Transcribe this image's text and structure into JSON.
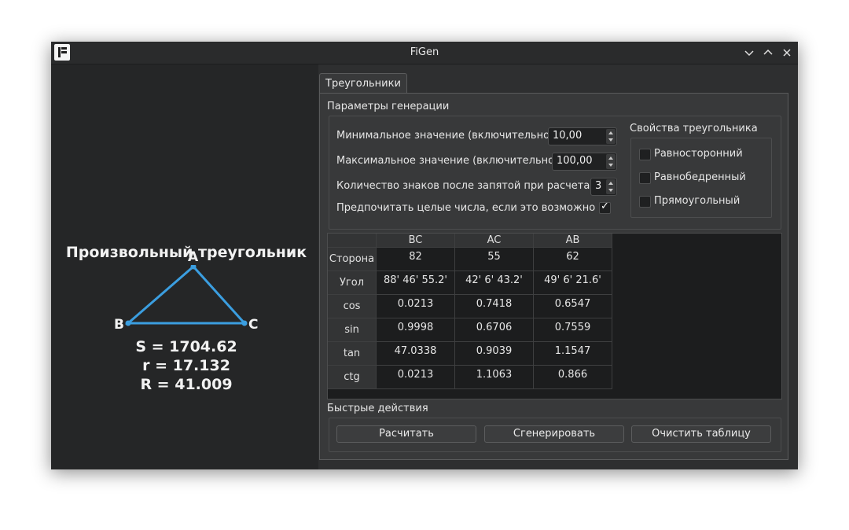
{
  "window": {
    "title": "FiGen"
  },
  "preview": {
    "title": "Произвольный треугольник",
    "vertices": {
      "a": "A",
      "b": "B",
      "c": "C"
    },
    "area": "S = 1704.62",
    "inradius": "r = 17.132",
    "circumradius": "R = 41.009",
    "colors": {
      "triangle": "#3b9ee0"
    }
  },
  "tab": {
    "label": "Треугольники"
  },
  "params": {
    "group_title": "Параметры генерации",
    "min_label": "Минимальное значение (включительно):",
    "min_value": "10,00",
    "max_label": "Максимальное значение (включительно):",
    "max_value": "100,00",
    "decimals_label": "Количество знаков после запятой при расчетах:",
    "decimals_value": "3",
    "prefer_int_label": "Предпочитать целые числа, если это возможно",
    "prefer_int_checked": true
  },
  "properties": {
    "title": "Свойства треугольника",
    "items": [
      {
        "label": "Равносторонний",
        "checked": false
      },
      {
        "label": "Равнобедренный",
        "checked": false
      },
      {
        "label": "Прямоугольный",
        "checked": false
      }
    ]
  },
  "table": {
    "columns": [
      "BC",
      "AC",
      "AB"
    ],
    "rows": [
      {
        "header": "Сторона",
        "cells": [
          "82",
          "55",
          "62"
        ]
      },
      {
        "header": "Угол",
        "cells": [
          "88' 46' 55.2'",
          "42' 6' 43.2'",
          "49' 6' 21.6'"
        ]
      },
      {
        "header": "cos",
        "cells": [
          "0.0213",
          "0.7418",
          "0.6547"
        ]
      },
      {
        "header": "sin",
        "cells": [
          "0.9998",
          "0.6706",
          "0.7559"
        ]
      },
      {
        "header": "tan",
        "cells": [
          "47.0338",
          "0.9039",
          "1.1547"
        ]
      },
      {
        "header": "ctg",
        "cells": [
          "0.0213",
          "1.1063",
          "0.866"
        ]
      }
    ]
  },
  "actions": {
    "group_title": "Быстрые действия",
    "calculate": "Расчитать",
    "generate": "Сгенерировать",
    "clear": "Очистить таблицу"
  }
}
